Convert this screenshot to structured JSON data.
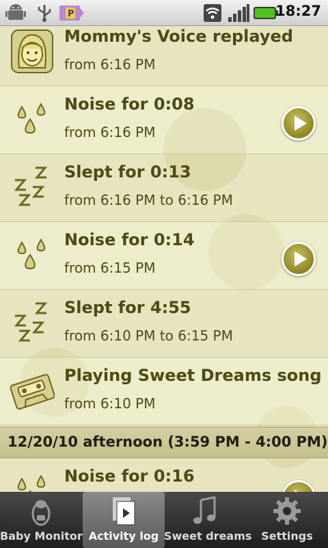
{
  "status_bar": {
    "time": "18:27",
    "icons": [
      "android-debug-icon",
      "usb-icon",
      "notification-p-icon",
      "wifi-icon",
      "signal-icon",
      "battery-icon"
    ]
  },
  "log_entries": [
    {
      "icon": "mommy-face-icon",
      "title": "Mommy's Voice replayed",
      "subtitle": "from 6:16 PM",
      "playable": false
    },
    {
      "icon": "noise-drops-icon",
      "title": "Noise for 0:08",
      "subtitle": "from 6:16 PM",
      "playable": true
    },
    {
      "icon": "sleep-zzz-icon",
      "title": "Slept for 0:13",
      "subtitle": "from 6:16 PM to 6:16 PM",
      "playable": false
    },
    {
      "icon": "noise-drops-icon",
      "title": "Noise for 0:14",
      "subtitle": "from 6:15 PM",
      "playable": true
    },
    {
      "icon": "sleep-zzz-icon",
      "title": "Slept for 4:55",
      "subtitle": "from 6:10 PM to 6:15 PM",
      "playable": false
    },
    {
      "icon": "cassette-icon",
      "title": "Playing Sweet Dreams song",
      "subtitle": "from 6:10 PM",
      "playable": false
    }
  ],
  "section_header": "12/20/10 afternoon (3:59 PM - 4:00 PM)",
  "partial_entry": {
    "icon": "noise-drops-icon",
    "title": "Noise for 0:16"
  },
  "tabs": [
    {
      "label": "Baby Monitor",
      "icon": "baby-monitor-icon",
      "active": false
    },
    {
      "label": "Activity log",
      "icon": "activity-log-icon",
      "active": true
    },
    {
      "label": "Sweet dreams",
      "icon": "music-note-icon",
      "active": false
    },
    {
      "label": "Settings",
      "icon": "gear-icon",
      "active": false
    }
  ],
  "colors": {
    "accent": "#8d8622",
    "text": "#4d4a16",
    "background": "#e7e5c0"
  }
}
